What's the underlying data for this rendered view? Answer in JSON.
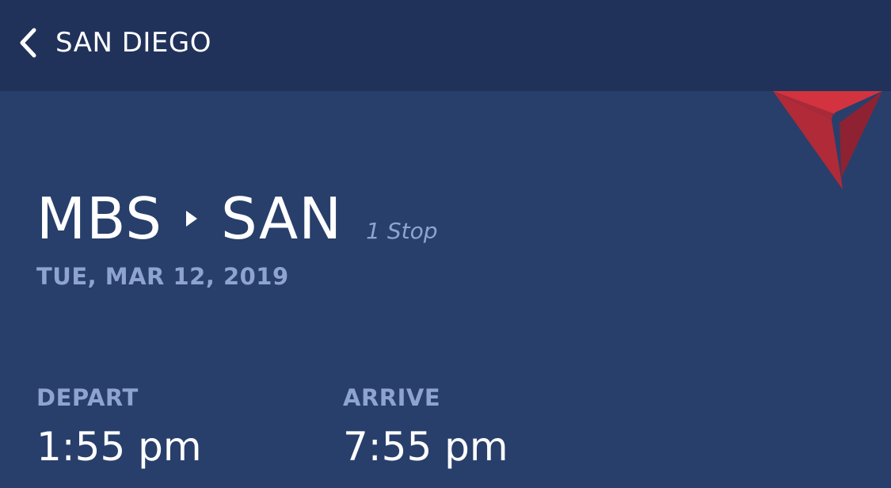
{
  "header": {
    "back_icon": "chevron-left-icon",
    "title": "SAN DIEGO"
  },
  "brand": {
    "logo_icon": "widget-triangle-logo",
    "colors": {
      "logo_light": "#d2333f",
      "logo_dark": "#8e2232",
      "accent": "#283f6b"
    }
  },
  "trip": {
    "origin": "MBS",
    "destination": "SAN",
    "route_arrow_icon": "play-arrow-icon",
    "stops": "1 Stop",
    "date": "TUE, MAR 12, 2019"
  },
  "times": {
    "depart_label": "DEPART",
    "depart_time": "1:55 pm",
    "arrive_label": "ARRIVE",
    "arrive_time": "7:55 pm"
  },
  "colors": {
    "background": "#283f6b",
    "nav_background": "#20325a",
    "muted_text": "#8fa3d0",
    "primary_text": "#ffffff"
  }
}
